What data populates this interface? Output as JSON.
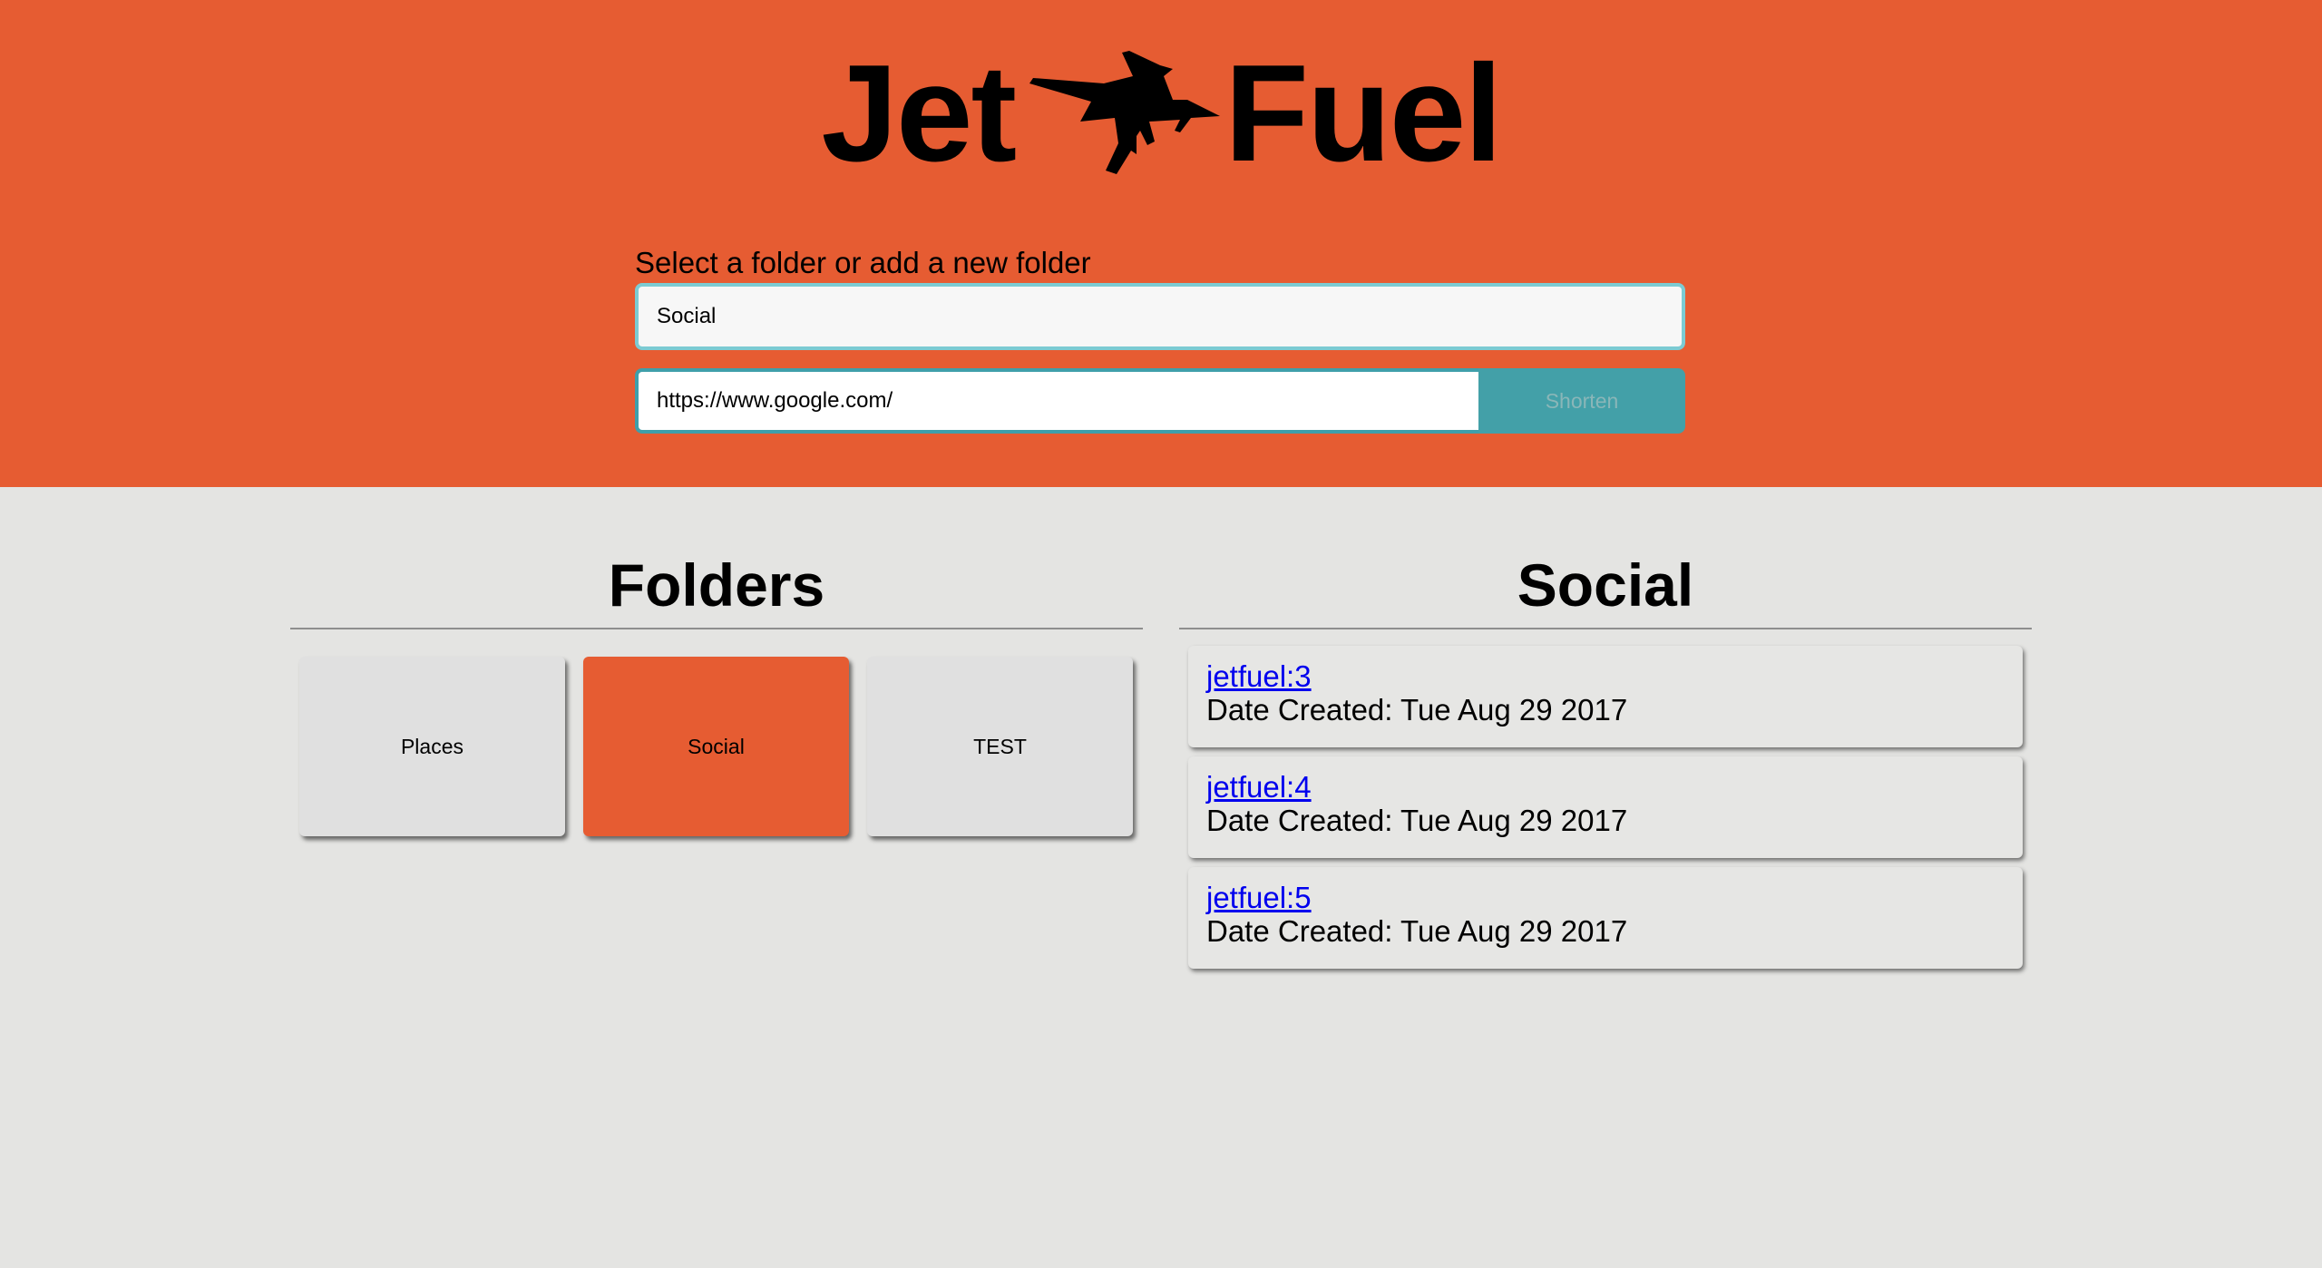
{
  "header": {
    "logo": {
      "word_left": "Jet",
      "word_right": "Fuel",
      "icon": "fighter-jet-icon"
    },
    "folder_label": "Select a folder or add a new folder",
    "folder_input_value": "Social",
    "url_input_value": "https://www.google.com/",
    "shorten_label": "Shorten"
  },
  "folders": {
    "title": "Folders",
    "items": [
      {
        "label": "Places",
        "active": false
      },
      {
        "label": "Social",
        "active": true
      },
      {
        "label": "TEST",
        "active": false
      }
    ]
  },
  "links": {
    "title": "Social",
    "items": [
      {
        "short": "jetfuel:3",
        "date": "Date Created: Tue Aug 29 2017"
      },
      {
        "short": "jetfuel:4",
        "date": "Date Created: Tue Aug 29 2017"
      },
      {
        "short": "jetfuel:5",
        "date": "Date Created: Tue Aug 29 2017"
      }
    ]
  },
  "colors": {
    "brand_orange": "#e65c32",
    "accent_teal": "#43a0a8",
    "page_background": "#e4e4e2"
  }
}
